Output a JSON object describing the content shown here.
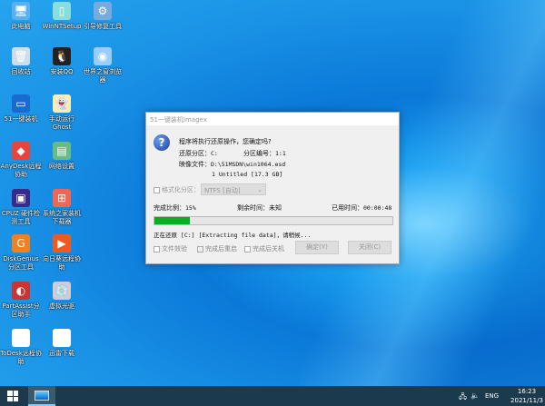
{
  "desktop": {
    "icons": [
      {
        "label": "此电脑",
        "glyph": "🖥",
        "color": "#5ab0f0"
      },
      {
        "label": "WinNTSetup",
        "glyph": "▯",
        "color": "#8dd"
      },
      {
        "label": "引导修复工具",
        "glyph": "⚙",
        "color": "#7ad"
      },
      {
        "label": "回收站",
        "glyph": "🗑",
        "color": "#cde"
      },
      {
        "label": "安装QQ",
        "glyph": "🐧",
        "color": "#222"
      },
      {
        "label": "世界之窗浏览器",
        "glyph": "◉",
        "color": "#9cf"
      },
      {
        "label": "51一键装机",
        "glyph": "▭",
        "color": "#1a6ad0"
      },
      {
        "label": "手动运行Ghost",
        "glyph": "👻",
        "color": "#f5eebb"
      },
      {
        "label": "AnyDesk远程协助",
        "glyph": "◆",
        "color": "#e8443a"
      },
      {
        "label": "网络设置",
        "glyph": "▤",
        "color": "#6b8"
      },
      {
        "label": "CPUZ 硬件检测工具",
        "glyph": "▣",
        "color": "#3a2a8a"
      },
      {
        "label": "系统之家装机下载器",
        "glyph": "⊞",
        "color": "#e65"
      },
      {
        "label": "DiskGenius分区工具",
        "glyph": "G",
        "color": "#f08020"
      },
      {
        "label": "向日葵远程协助",
        "glyph": "▶",
        "color": "#f05a20"
      },
      {
        "label": "PartAssist分区助手",
        "glyph": "◐",
        "color": "#c33"
      },
      {
        "label": "虚拟光驱",
        "glyph": "💿",
        "color": "#ccd"
      },
      {
        "label": "ToDesk远程协助",
        "glyph": "T",
        "color": "#fff"
      },
      {
        "label": "迅雷下载",
        "glyph": "✈",
        "color": "#fff"
      }
    ]
  },
  "dialog": {
    "title": "51一键装机Imagex",
    "question": "程序将执行还原操作，您确定吗?",
    "partition_label": "还原分区：",
    "partition_value": "C:",
    "partition_no_label": "分区编号：",
    "partition_no_value": "1:1",
    "image_label": "映像文件：",
    "image_value": "D:\\51MSDN\\win1064.esd",
    "image_sub": "1 Untitled [17.3 GB]",
    "format_label": "格式化分区：",
    "format_value": "NTFS [自动]",
    "progress_label": "完成比例：",
    "progress_text": "15%",
    "progress": 15,
    "remaining_label": "剩余时间：",
    "remaining_value": "未知",
    "elapsed_label": "已用时间：",
    "elapsed_value": "00:00:48",
    "status": "正在还原 [C:] [Extracting file data]，请稍候...",
    "verify_label": "文件效验",
    "reboot_label": "完成后重启",
    "shutdown_label": "完成后关机",
    "ok_button": "确定(Y)",
    "close_button": "关闭(C)"
  },
  "taskbar": {
    "lang": "ENG",
    "time": "16:23",
    "date": "2021/11/3"
  }
}
